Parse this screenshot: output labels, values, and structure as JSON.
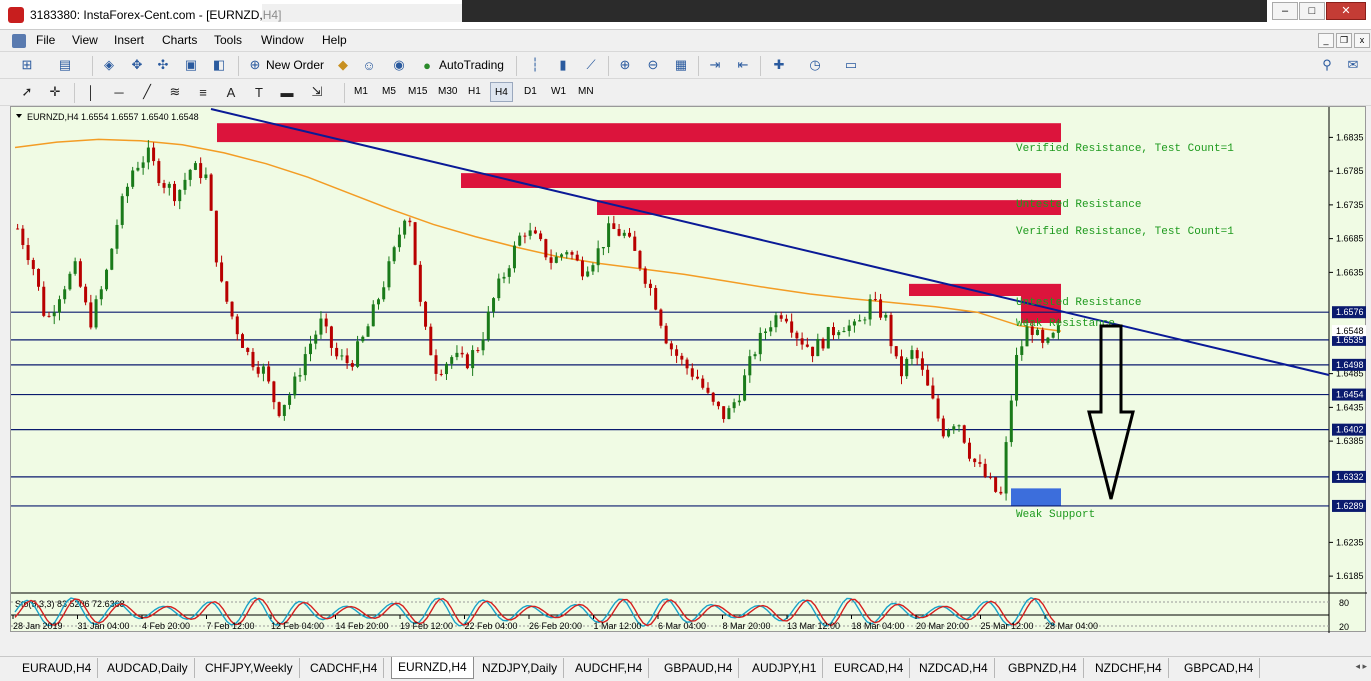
{
  "window": {
    "title": "3183380: InstaForex-Cent.com - [EURNZD,H4]"
  },
  "menu": [
    "File",
    "View",
    "Insert",
    "Charts",
    "Tools",
    "Window",
    "Help"
  ],
  "toolbar1": {
    "new_order": "New Order",
    "auto_trading": "AutoTrading"
  },
  "timeframes": [
    "M1",
    "M5",
    "M15",
    "M30",
    "H1",
    "H4",
    "D1",
    "W1",
    "MN"
  ],
  "active_timeframe": "H4",
  "chart": {
    "header": "EURNZD,H4  1.6554 1.6557 1.6540 1.6548",
    "y_ticks": [
      "1.6835",
      "1.6785",
      "1.6735",
      "1.6685",
      "1.6635",
      "1.6485",
      "1.6435",
      "1.6385",
      "1.6235",
      "1.6185"
    ],
    "level_labels": [
      "1.6576",
      "1.6535",
      "1.6498",
      "1.6454",
      "1.6402",
      "1.6332",
      "1.6289"
    ],
    "current_price": "1.6548",
    "x_ticks": [
      "28 Jan 2019",
      "31 Jan 04:00",
      "4 Feb 20:00",
      "7 Feb 12:00",
      "12 Feb 04:00",
      "14 Feb 20:00",
      "19 Feb 12:00",
      "22 Feb 04:00",
      "26 Feb 20:00",
      "1 Mar 12:00",
      "6 Mar 04:00",
      "8 Mar 20:00",
      "13 Mar 12:00",
      "18 Mar 04:00",
      "20 Mar 20:00",
      "25 Mar 12:00",
      "28 Mar 04:00"
    ],
    "zones": [
      {
        "label": "Verified Resistance, Test Count=1"
      },
      {
        "label": "Untested Resistance"
      },
      {
        "label": "Verified Resistance, Test Count=1"
      },
      {
        "label": "Untested Resistance"
      },
      {
        "label": "Weak Resistance"
      },
      {
        "label": "Weak Support"
      }
    ],
    "indicator_header": "Sto(5,3,3) 83.5206 72.6368",
    "indicator_ticks": [
      "80",
      "20"
    ],
    "colors": {
      "background": "#f0fbe4",
      "candle": "#b80000",
      "candle_up": "#1a7a1a",
      "ma": "#f39c24",
      "zone": "#dc143c",
      "support": "#3c6edc",
      "trend": "#0a1a96",
      "levels": "#0a1a6e"
    }
  },
  "chart_data": {
    "type": "candlestick",
    "symbol": "EURNZD",
    "timeframe": "H4",
    "ohlc_last": {
      "open": 1.6554,
      "high": 1.6557,
      "low": 1.654,
      "close": 1.6548
    },
    "y_range": [
      1.616,
      1.688
    ],
    "horizontal_levels": [
      1.6576,
      1.6535,
      1.6498,
      1.6454,
      1.6402,
      1.6332,
      1.6289
    ],
    "resistance_zones": [
      [
        1.6828,
        1.6856
      ],
      [
        1.676,
        1.6782
      ],
      [
        1.672,
        1.6742
      ],
      [
        1.66,
        1.6618
      ],
      [
        1.656,
        1.66
      ]
    ],
    "support_zones": [
      [
        1.6289,
        1.6315
      ]
    ],
    "close_path": [
      1.67,
      1.665,
      1.656,
      1.661,
      1.664,
      1.656,
      1.662,
      1.672,
      1.679,
      1.681,
      1.677,
      1.675,
      1.679,
      1.678,
      1.662,
      1.656,
      1.651,
      1.649,
      1.643,
      1.646,
      1.652,
      1.656,
      1.651,
      1.65,
      1.654,
      1.66,
      1.666,
      1.674,
      1.656,
      1.649,
      1.651,
      1.65,
      1.653,
      1.66,
      1.665,
      1.67,
      1.668,
      1.665,
      1.667,
      1.664,
      1.666,
      1.67,
      1.669,
      1.665,
      1.66,
      1.653,
      1.65,
      1.648,
      1.644,
      1.642,
      1.646,
      1.652,
      1.656,
      1.658,
      1.654,
      1.652,
      1.654,
      1.656,
      1.655,
      1.659,
      1.657,
      1.648,
      1.652,
      1.646,
      1.64,
      1.642,
      1.636,
      1.633,
      1.63,
      1.65,
      1.656,
      1.652,
      1.6548
    ]
  }
}
